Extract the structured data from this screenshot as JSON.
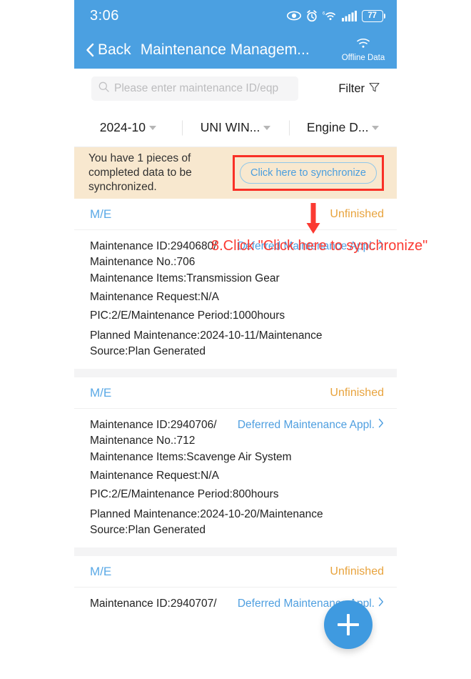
{
  "statusbar": {
    "time": "3:06",
    "battery_percent": "77",
    "icons": [
      "eye-icon",
      "alarm-clock-icon",
      "wifi-6-icon",
      "cellular-signal-icon",
      "battery-icon"
    ]
  },
  "navbar": {
    "back_label": "Back",
    "title": "Maintenance Managem...",
    "offline_label": "Offline Data"
  },
  "search": {
    "placeholder": "Please enter maintenance ID/eqp",
    "value": "",
    "filter_label": "Filter"
  },
  "filters": [
    {
      "label": "2024-10"
    },
    {
      "label": "UNI WIN..."
    },
    {
      "label": "Engine D..."
    }
  ],
  "banner": {
    "message": "You have 1 pieces of completed data to be synchronized.",
    "sync_button": "Click here to synchronize",
    "highlight_color": "#f93026",
    "background": "#f8e8cf"
  },
  "annotation": {
    "step_text": "8.Click \"Click here to synchronize\"",
    "color": "#fb3a32"
  },
  "cards": [
    {
      "dept": "M/E",
      "status": "Unfinished",
      "id_line": "Maintenance ID:2940680/ Maintenance No.:706",
      "deferred_label": "Deferred Maintenance Appl.",
      "items": "Maintenance Items:Transmission Gear",
      "request": "Maintenance Request:N/A",
      "pic": "PIC:2/E/Maintenance Period:1000hours",
      "planned": "Planned Maintenance:2024-10-11/Maintenance Source:Plan Generated"
    },
    {
      "dept": "M/E",
      "status": "Unfinished",
      "id_line": "Maintenance ID:2940706/ Maintenance No.:712",
      "deferred_label": "Deferred Maintenance Appl.",
      "items": "Maintenance Items:Scavenge Air System",
      "request": "Maintenance Request:N/A",
      "pic": "PIC:2/E/Maintenance Period:800hours",
      "planned": "Planned Maintenance:2024-10-20/Maintenance Source:Plan Generated"
    },
    {
      "dept": "M/E",
      "status": "Unfinished",
      "id_line": "Maintenance ID:2940707/",
      "deferred_label": "Deferred Maintenance Appl."
    }
  ],
  "fab": {
    "label": "+"
  },
  "theme": {
    "primary": "#4ba0e1",
    "link": "#4f9fe0",
    "status_orange": "#e8a33d"
  }
}
